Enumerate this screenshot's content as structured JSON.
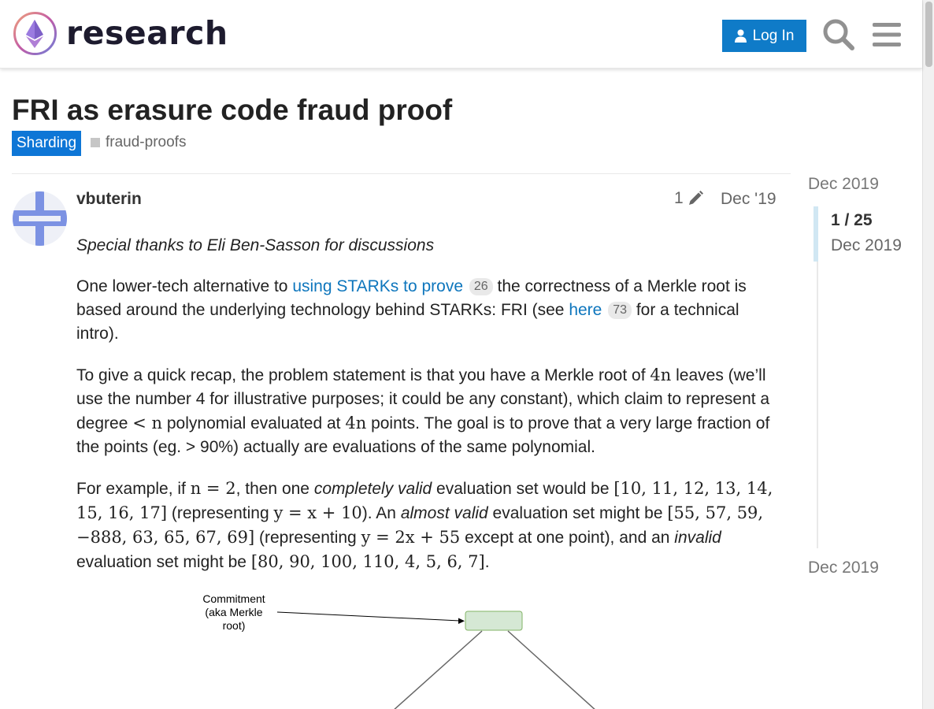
{
  "header": {
    "site_name": "research",
    "login_label": "Log In",
    "icons": {
      "logo": "ethereum-research-logo",
      "user": "user-icon",
      "search": "search-icon",
      "menu": "hamburger-menu-icon"
    }
  },
  "topic": {
    "title": "FRI as erasure code fraud proof",
    "category": "Sharding",
    "tag": "fraud-proofs"
  },
  "post": {
    "username": "vbuterin",
    "edit_count": "1",
    "date": "Dec '19",
    "intro_italic": "Special thanks to Eli Ben-Sasson for discussions",
    "p1": {
      "t1": "One lower-tech alternative to ",
      "link1": "using STARKs to prove",
      "link1_clicks": "26",
      "t2": " the correctness of a Merkle root is based around the underlying technology behind STARKs: FRI (see ",
      "link2": "here",
      "link2_clicks": "73",
      "t3": " for a technical intro)."
    },
    "p2": {
      "t1": "To give a quick recap, the problem statement is that you have a Merkle root of ",
      "m1": "4n",
      "t2": " leaves (we’ll use the number 4 for illustrative purposes; it could be any constant), which claim to represent a degree ",
      "m2": "< n",
      "t3": " polynomial evaluated at ",
      "m3": "4n",
      "t4": " points. The goal is to prove that a very large fraction of the points (eg. > 90%) actually are evaluations of the same polynomial."
    },
    "p3": {
      "t1": "For example, if ",
      "m1": "n = 2",
      "t2": ", then one ",
      "e1": "completely valid",
      "t3": " evaluation set would be ",
      "m2": "[10, 11, 12, 13, 14, 15, 16, 17]",
      "t4": " (representing ",
      "m3": "y = x + 10",
      "t5": "). An ",
      "e2": "almost valid",
      "t6": " evaluation set might be ",
      "m4": "[55, 57, 59, −888, 63, 65, 67, 69]",
      "t7": " (representing ",
      "m5": "y = 2x + 55",
      "t8": " except at one point), and an ",
      "e3": "invalid",
      "t9": " evaluation set might be ",
      "m6": "[80, 90, 100, 110, 4, 5, 6, 7]",
      "t10": "."
    },
    "diagram": {
      "label_line1": "Commitment",
      "label_line2": "(aka Merkle",
      "label_line3": "root)"
    }
  },
  "timeline": {
    "top_date": "Dec 2019",
    "position": "1 / 25",
    "position_date": "Dec 2019",
    "bottom_date": "Dec 2019"
  },
  "colors": {
    "primary": "#0f7bc8",
    "category": "#0e76d6",
    "link": "#0e76bd",
    "node_fill": "#d5e8d4",
    "node_stroke": "#82b366"
  }
}
